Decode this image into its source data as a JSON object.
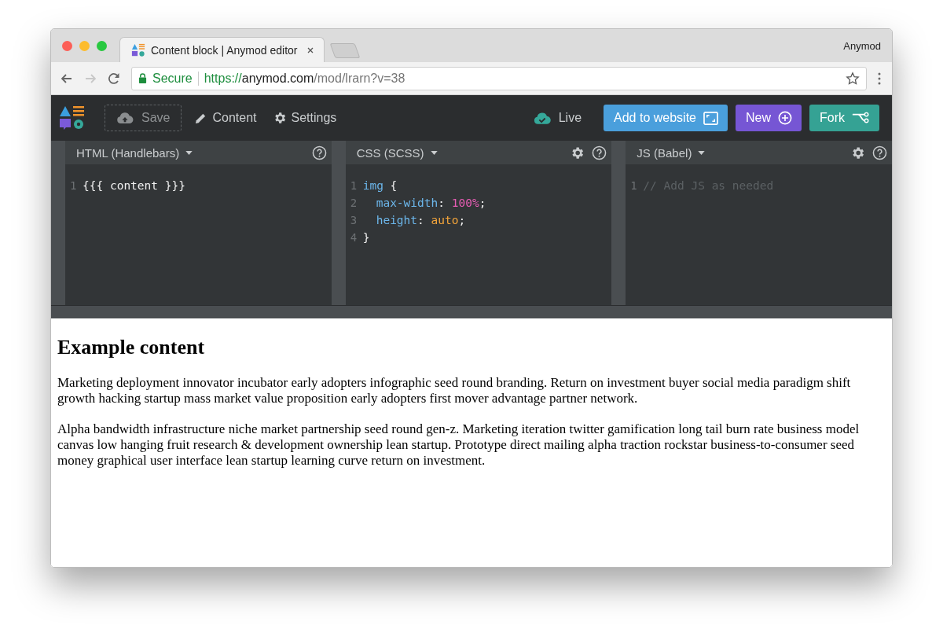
{
  "window": {
    "tab_title": "Content block | Anymod editor",
    "profile": "Anymod"
  },
  "address_bar": {
    "secure_label": "Secure",
    "url_scheme": "https://",
    "url_host": "anymod.com",
    "url_path": "/mod/lrarn?v=38"
  },
  "toolbar": {
    "save": "Save",
    "content": "Content",
    "settings": "Settings",
    "status": "Live",
    "buttons": [
      {
        "label": "Add to website",
        "kind": "embed"
      },
      {
        "label": "New",
        "kind": "new"
      },
      {
        "label": "Fork",
        "kind": "fork"
      }
    ]
  },
  "panes": [
    {
      "title": "HTML (Handlebars)",
      "settings": false,
      "lines": [
        {
          "number": "1",
          "indented": false,
          "tokens": [
            {
              "kind": "plain",
              "text": "{{{ content }}}"
            }
          ]
        }
      ]
    },
    {
      "title": "CSS (SCSS)",
      "settings": true,
      "lines": [
        {
          "number": "1",
          "indented": false,
          "tokens": [
            {
              "kind": "selector",
              "text": "img"
            },
            {
              "kind": "plain",
              "text": " {"
            }
          ]
        },
        {
          "number": "2",
          "indented": true,
          "tokens": [
            {
              "kind": "property",
              "text": "max-width"
            },
            {
              "kind": "plain",
              "text": ": "
            },
            {
              "kind": "number",
              "text": "100%"
            },
            {
              "kind": "plain",
              "text": ";"
            }
          ]
        },
        {
          "number": "3",
          "indented": true,
          "tokens": [
            {
              "kind": "property",
              "text": "height"
            },
            {
              "kind": "plain",
              "text": ": "
            },
            {
              "kind": "value",
              "text": "auto"
            },
            {
              "kind": "plain",
              "text": ";"
            }
          ]
        },
        {
          "number": "4",
          "indented": false,
          "tokens": [
            {
              "kind": "plain",
              "text": "}"
            }
          ]
        }
      ]
    },
    {
      "title": "JS (Babel)",
      "settings": true,
      "lines": [
        {
          "number": "1",
          "indented": false,
          "tokens": [
            {
              "kind": "comment",
              "text": "// Add JS as needed"
            }
          ]
        }
      ]
    }
  ],
  "preview": {
    "heading": "Example content",
    "paragraphs": [
      "Marketing deployment innovator incubator early adopters infographic seed round branding. Return on investment buyer social media paradigm shift growth hacking startup mass market value proposition early adopters first mover advantage partner network.",
      "Alpha bandwidth infrastructure niche market partnership seed round gen-z. Marketing iteration twitter gamification long tail burn rate business model canvas low hanging fruit research & development ownership lean startup. Prototype direct mailing alpha traction rockstar business-to-consumer seed money graphical user interface lean startup learning curve return on investment."
    ]
  }
}
